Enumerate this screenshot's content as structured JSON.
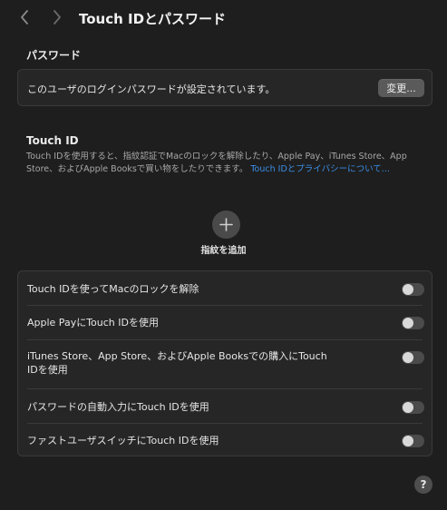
{
  "toolbar": {
    "title": "Touch IDとパスワード"
  },
  "password": {
    "heading": "パスワード",
    "status_text": "このユーザのログインパスワードが設定されています。",
    "change_button": "変更..."
  },
  "touch_id": {
    "heading": "Touch ID",
    "description": "Touch IDを使用すると、指紋認証でMacのロックを解除したり、Apple Pay、iTunes Store、App Store、およびApple Booksで買い物をしたりできます。",
    "link_text": "Touch IDとプライバシーについて...",
    "add_fingerprint_label": "指紋を追加",
    "link_color": "#3a8ee6"
  },
  "options": [
    {
      "label": "Touch IDを使ってMacのロックを解除",
      "enabled": false
    },
    {
      "label": "Apple PayにTouch IDを使用",
      "enabled": false
    },
    {
      "label": "iTunes Store、App Store、およびApple Booksでの購入にTouch IDを使用",
      "enabled": false
    },
    {
      "label": "パスワードの自動入力にTouch IDを使用",
      "enabled": false
    },
    {
      "label": "ファストユーザスイッチにTouch IDを使用",
      "enabled": false
    }
  ],
  "help": {
    "label": "?"
  },
  "icons": {
    "back": "chevron-left-icon",
    "forward": "chevron-right-icon",
    "add": "plus-icon"
  }
}
